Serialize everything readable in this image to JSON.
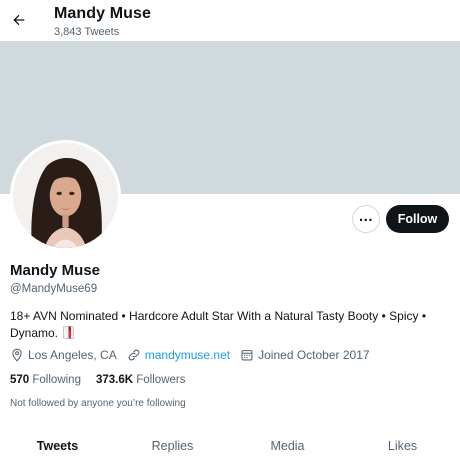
{
  "header": {
    "name": "Mandy Muse",
    "tweet_count": "3,843 Tweets"
  },
  "profile": {
    "name": "Mandy Muse",
    "handle": "@MandyMuse69",
    "bio": "18+ AVN Nominated • Hardcore Adult Star With a Natural Tasty Booty • Spicy • Dynamo.",
    "location": "Los Angeles, CA",
    "website": "mandymuse.net",
    "joined": "Joined October 2017",
    "following_count": "570",
    "following_label": "Following",
    "followers_count": "373.6K",
    "followers_label": "Followers",
    "not_followed": "Not followed by anyone you’re following"
  },
  "actions": {
    "more_label": "...",
    "follow_label": "Follow"
  },
  "tabs": [
    {
      "label": "Tweets",
      "active": true
    },
    {
      "label": "Replies",
      "active": false
    },
    {
      "label": "Media",
      "active": false
    },
    {
      "label": "Likes",
      "active": false
    }
  ],
  "colors": {
    "banner": "#cfd9de",
    "link": "#1d9bf0",
    "follow_bg": "#0f1419",
    "secondary_text": "#536471"
  },
  "icons": {
    "back": "arrow-left-icon",
    "location": "location-pin-icon",
    "website": "link-icon",
    "joined": "calendar-icon",
    "bio_emoji": "red-book-icon"
  }
}
